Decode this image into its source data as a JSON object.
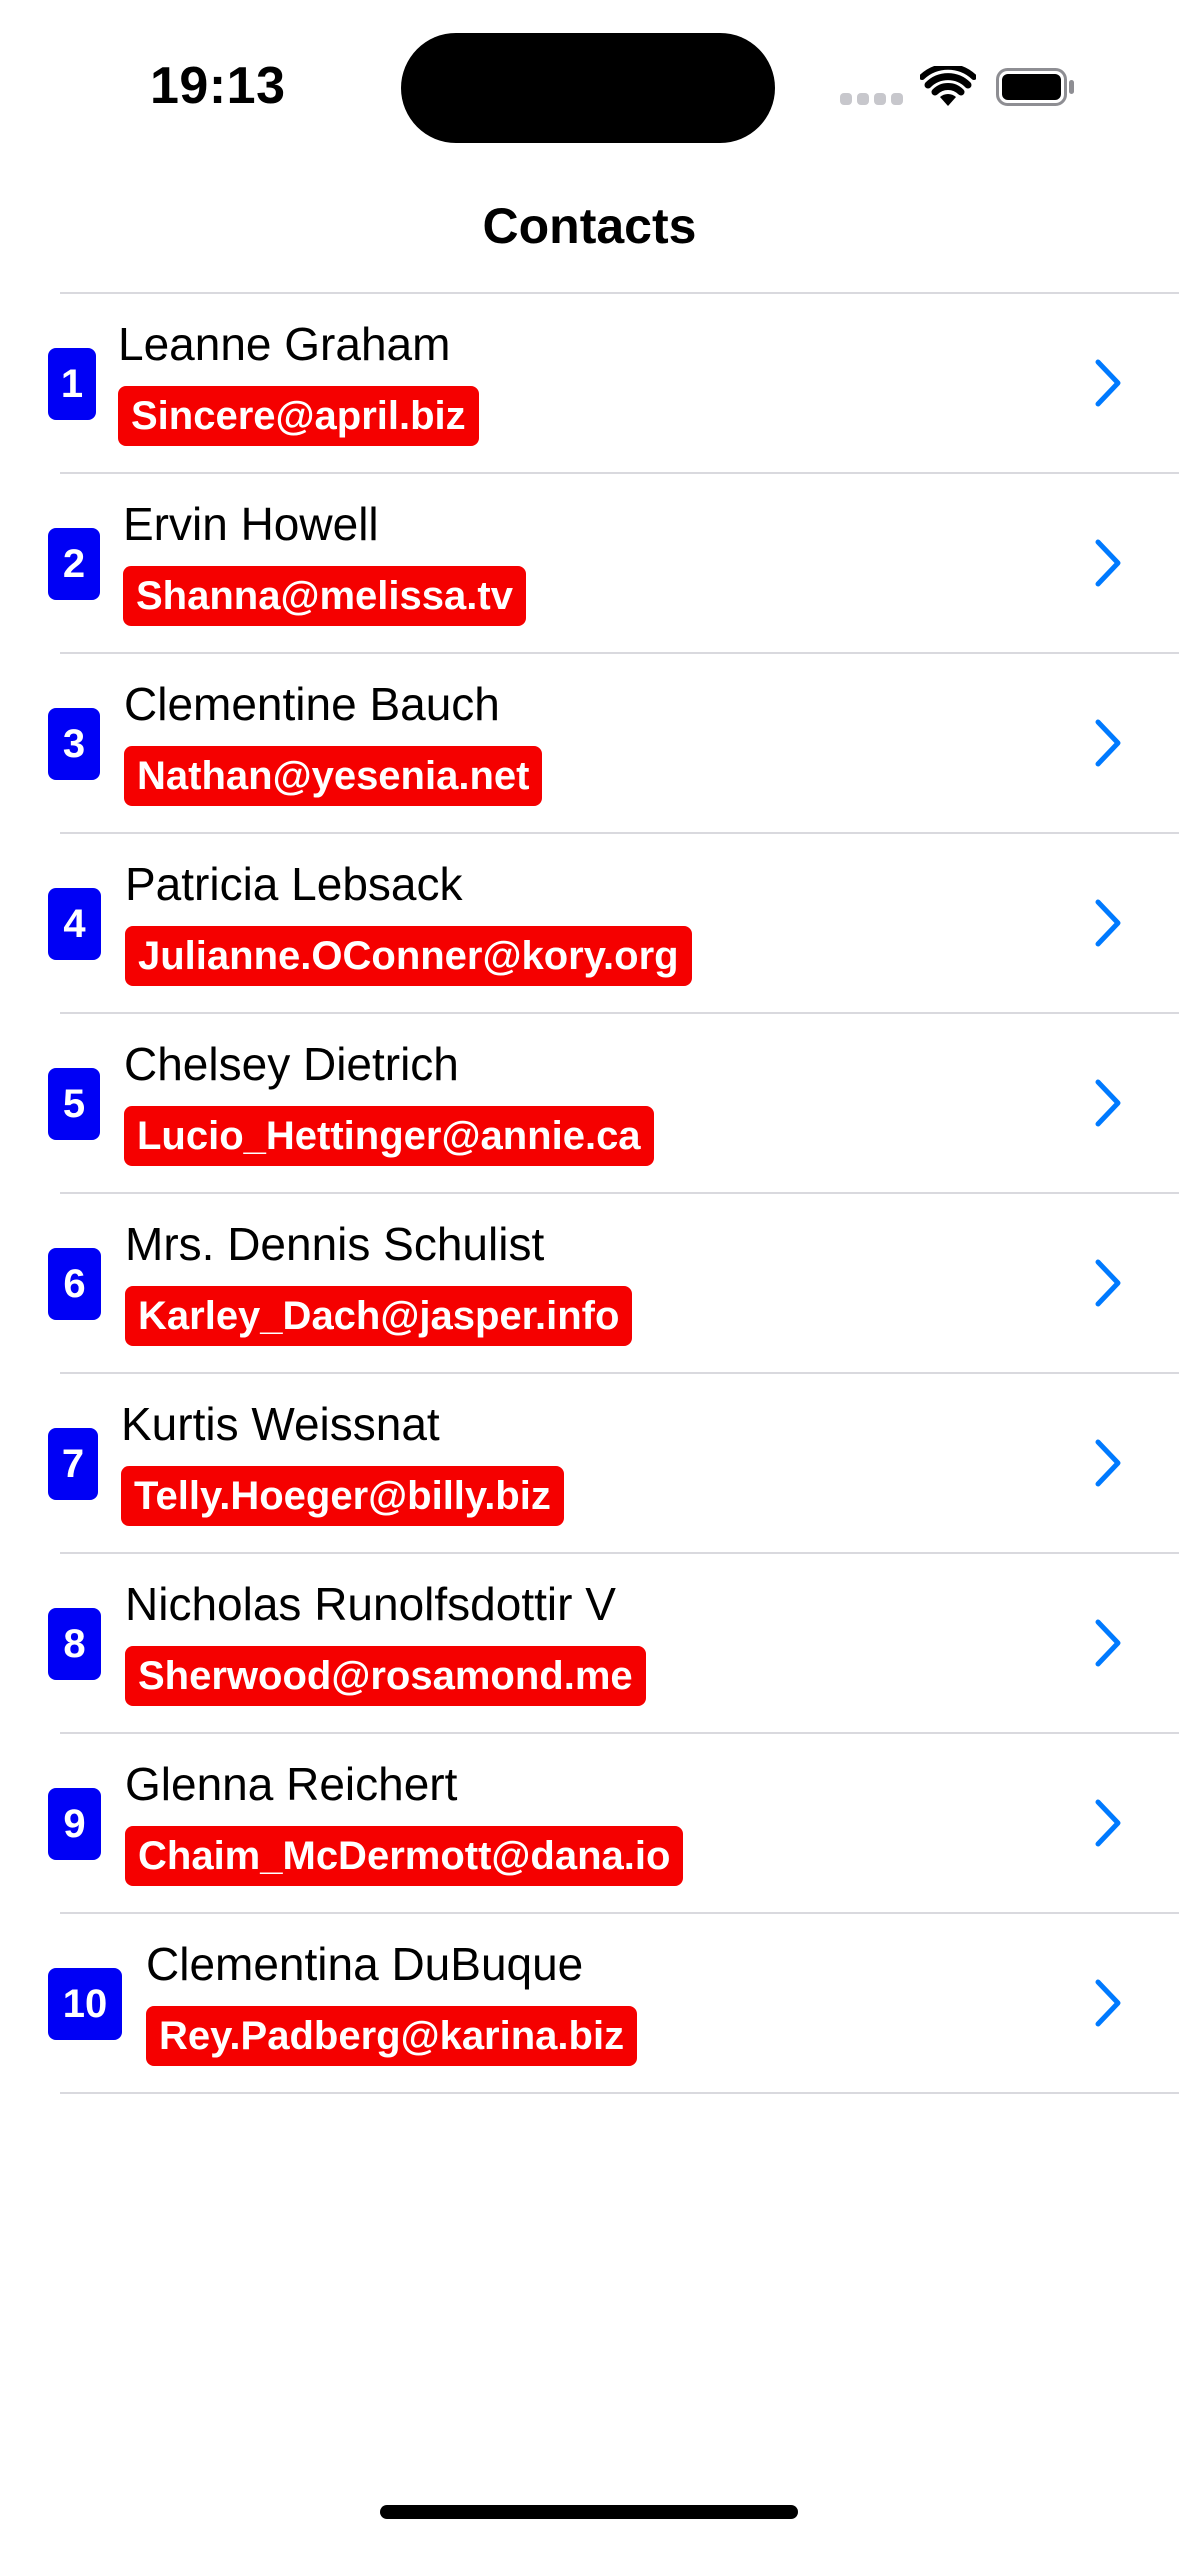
{
  "status_bar": {
    "time": "19:13"
  },
  "nav": {
    "title": "Contacts"
  },
  "contacts": [
    {
      "number": "1",
      "name": "Leanne Graham",
      "email": "Sincere@april.biz"
    },
    {
      "number": "2",
      "name": "Ervin Howell",
      "email": "Shanna@melissa.tv"
    },
    {
      "number": "3",
      "name": "Clementine Bauch",
      "email": "Nathan@yesenia.net"
    },
    {
      "number": "4",
      "name": "Patricia Lebsack",
      "email": "Julianne.OConner@kory.org"
    },
    {
      "number": "5",
      "name": "Chelsey Dietrich",
      "email": "Lucio_Hettinger@annie.ca"
    },
    {
      "number": "6",
      "name": "Mrs. Dennis Schulist",
      "email": "Karley_Dach@jasper.info"
    },
    {
      "number": "7",
      "name": "Kurtis Weissnat",
      "email": "Telly.Hoeger@billy.biz"
    },
    {
      "number": "8",
      "name": "Nicholas Runolfsdottir V",
      "email": "Sherwood@rosamond.me"
    },
    {
      "number": "9",
      "name": "Glenna Reichert",
      "email": "Chaim_McDermott@dana.io"
    },
    {
      "number": "10",
      "name": "Clementina DuBuque",
      "email": "Rey.Padberg@karina.biz"
    }
  ],
  "colors": {
    "badge": "#0000f5",
    "email_badge": "#f50000",
    "chevron": "#007aff"
  },
  "icons": {
    "row_accessory": "chevron-right-icon",
    "wifi": "wifi-icon",
    "battery": "battery-icon",
    "signal": "cellular-signal-icon"
  }
}
